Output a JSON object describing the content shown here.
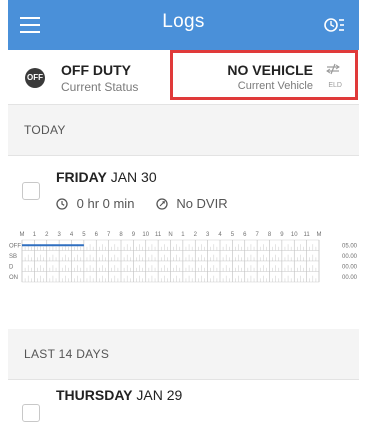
{
  "header": {
    "title": "Logs",
    "menu_icon": "hamburger-menu-icon",
    "right_icon": "log-settings-icon",
    "color": "#4a90d9"
  },
  "status": {
    "badge": "OFF",
    "main": "OFF DUTY",
    "sub": "Current Status"
  },
  "vehicle": {
    "main": "NO VEHICLE",
    "sub": "Current Vehicle",
    "eld_label": "ELD",
    "highlight_color": "#e03a3a"
  },
  "sections": {
    "today": "TODAY",
    "last14": "LAST 14 DAYS"
  },
  "today_log": {
    "day": "FRIDAY",
    "date": "JAN 30",
    "duration": "0 hr 0 min",
    "dvir": "No DVIR"
  },
  "graph": {
    "hour_labels": [
      "M",
      "1",
      "2",
      "3",
      "4",
      "5",
      "6",
      "7",
      "8",
      "9",
      "10",
      "11",
      "N",
      "1",
      "2",
      "3",
      "4",
      "5",
      "6",
      "7",
      "8",
      "9",
      "10",
      "11",
      "M"
    ],
    "rows": [
      "OFF",
      "SB",
      "D",
      "ON"
    ],
    "totals": [
      "05.00",
      "00.00",
      "00.00",
      "00.00"
    ],
    "off_duty_hours": 5
  },
  "previous_log": {
    "day": "THURSDAY",
    "date": "JAN 29"
  }
}
